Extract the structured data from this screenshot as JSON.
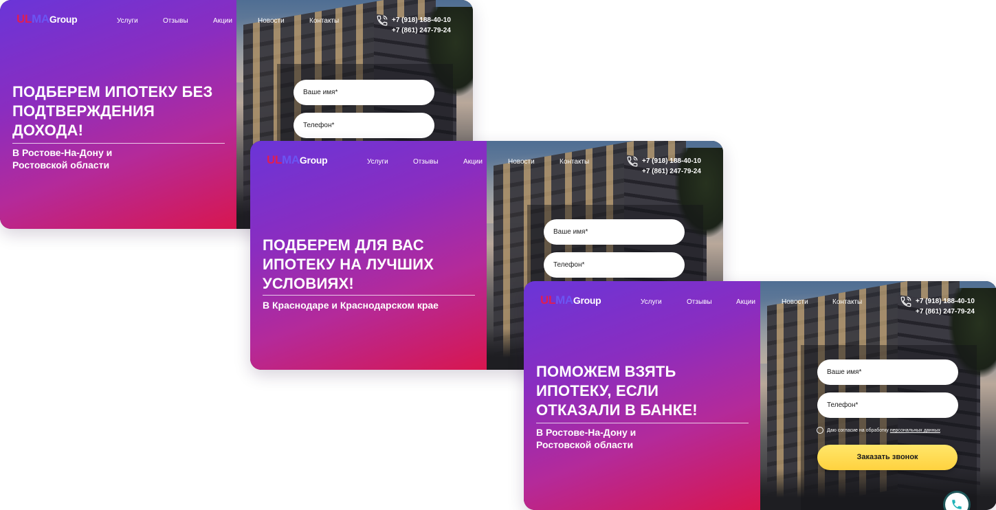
{
  "brand": {
    "part1": "UL",
    "part2": "MA",
    "part3": "Group"
  },
  "nav": [
    "Услуги",
    "Отзывы",
    "Акции",
    "Новости",
    "Контакты"
  ],
  "phones": [
    "+7 (918) 188-40-10",
    "+7 (861) 247-79-24"
  ],
  "form": {
    "name_placeholder": "Ваше имя*",
    "phone_placeholder": "Телефон*",
    "consent_text": "Даю согласие на обработку",
    "consent_link": "персональных данных",
    "submit_label": "Заказать звонок"
  },
  "cards": [
    {
      "headline": [
        "ПОДБЕРЕМ ИПОТЕКУ БЕЗ",
        "ПОДТВЕРЖДЕНИЯ",
        "ДОХОДА!"
      ],
      "subline": [
        "В Ростове-На-Дону и",
        "Ростовской области"
      ]
    },
    {
      "headline": [
        "ПОДБЕРЕМ ДЛЯ ВАС",
        "ИПОТЕКУ НА ЛУЧШИХ",
        "УСЛОВИЯХ!"
      ],
      "subline": [
        "В Краснодаре и Краснодарском крае"
      ]
    },
    {
      "headline": [
        "ПОМОЖЕМ ВЗЯТЬ",
        "ИПОТЕКУ, ЕСЛИ",
        "ОТКАЗАЛИ В БАНКЕ!"
      ],
      "subline": [
        "В Ростове-На-Дону и",
        "Ростовской области"
      ]
    }
  ],
  "colors": {
    "gradient_top": "#6a35d8",
    "gradient_bottom": "#d8164f",
    "logo_red": "#e01d53",
    "logo_violet": "#6b55f2",
    "cta_yellow": "#ffd23f"
  }
}
